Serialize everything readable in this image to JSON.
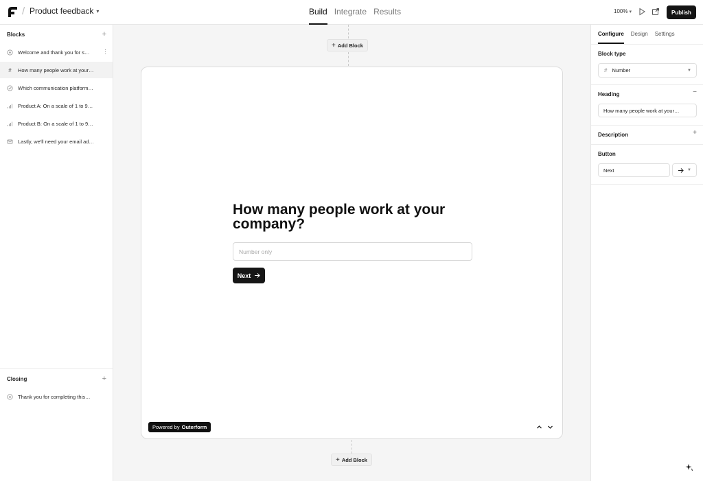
{
  "header": {
    "project_name": "Product feedback",
    "tabs": [
      {
        "label": "Build",
        "active": true
      },
      {
        "label": "Integrate",
        "active": false
      },
      {
        "label": "Results",
        "active": false
      }
    ],
    "zoom": "100%",
    "publish_label": "Publish"
  },
  "sidebar": {
    "blocks_title": "Blocks",
    "blocks": [
      {
        "label": "Welcome and thank you for s…",
        "icon": "welcome-icon"
      },
      {
        "label": "How many people work at your…",
        "icon": "hash-icon"
      },
      {
        "label": "Which communication platform…",
        "icon": "check-circle-icon"
      },
      {
        "label": "Product A: On a scale of 1 to 9…",
        "icon": "bar-chart-icon"
      },
      {
        "label": "Product B: On a scale of 1 to 9…",
        "icon": "bar-chart-icon"
      },
      {
        "label": "Lastly, we'll need your email ad…",
        "icon": "mail-icon"
      }
    ],
    "closing_title": "Closing",
    "closing": [
      {
        "label": "Thank you for completing this…",
        "icon": "thank-you-icon"
      }
    ]
  },
  "canvas": {
    "add_block_label": "Add Block",
    "heading": "How many people work at your company?",
    "input_placeholder": "Number only",
    "button_label": "Next",
    "powered_by_prefix": "Powered by",
    "powered_by_brand": "Outerform"
  },
  "inspector": {
    "tabs": [
      {
        "label": "Configure",
        "active": true
      },
      {
        "label": "Design",
        "active": false
      },
      {
        "label": "Settings",
        "active": false
      }
    ],
    "block_type_label": "Block type",
    "block_type_value": "Number",
    "heading_label": "Heading",
    "heading_value": "How many people work at your…",
    "description_label": "Description",
    "button_label": "Button",
    "button_value": "Next"
  }
}
